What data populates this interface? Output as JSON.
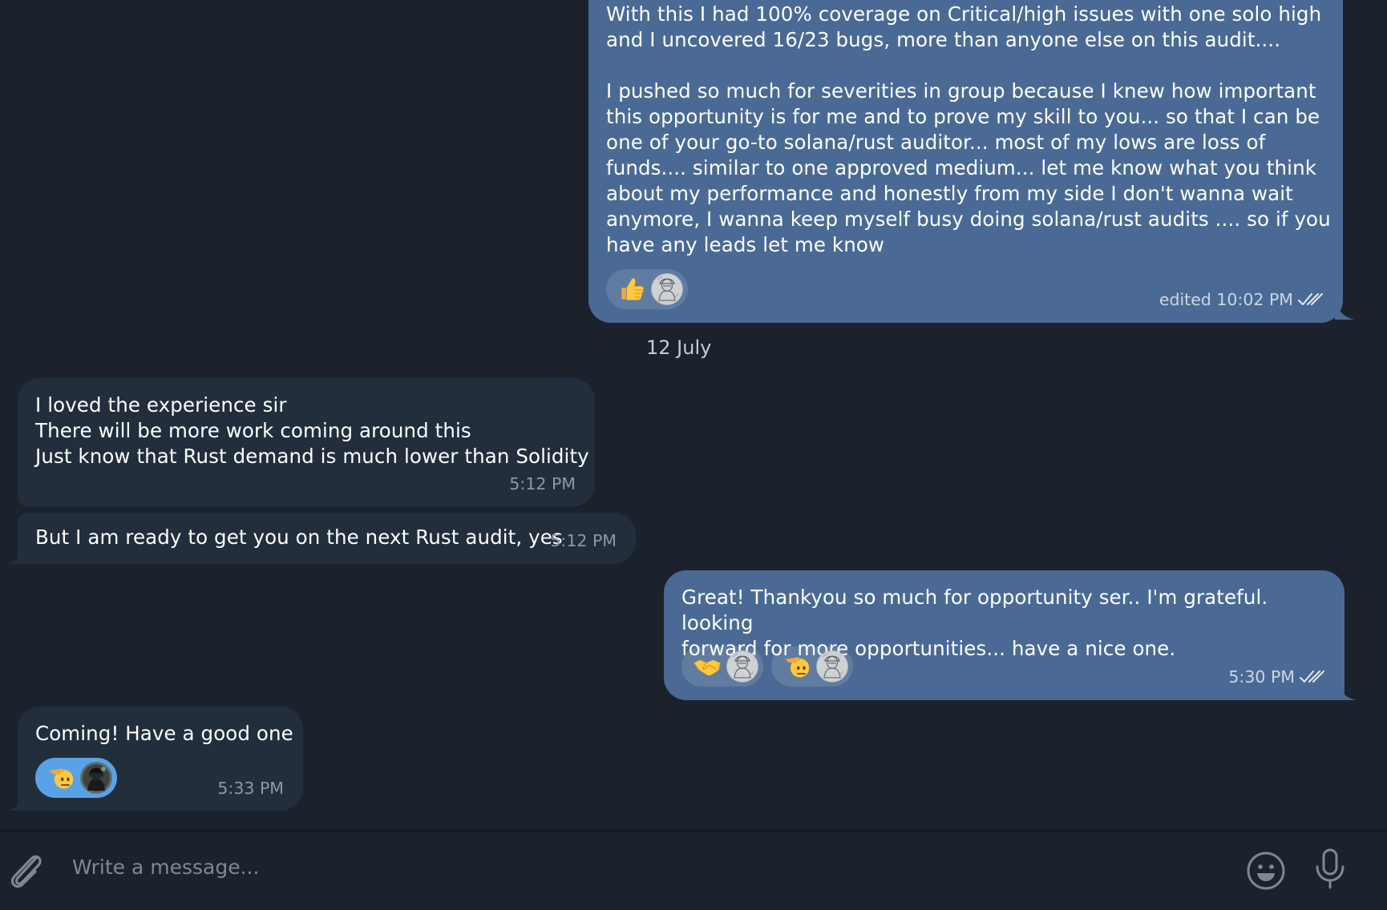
{
  "colors": {
    "background": "#1b222c",
    "outgoing_bubble": "#4a6a95",
    "incoming_bubble": "#232e3c",
    "active_reaction": "#5aa2e6",
    "read_check": "#ffffff"
  },
  "messages": [
    {
      "direction": "outgoing",
      "text": "With this I had 100% coverage on Critical/high issues with one solo high\nand I uncovered 16/23 bugs, more than anyone else on this audit....\n\nI pushed so much for severities in group because I knew how important\nthis opportunity is for me and to prove my skill to you... so that I can be\none of your go-to solana/rust auditor... most of my lows are loss of\nfunds.... similar to one approved medium... let me know what you think\nabout my performance and honestly from my side I don't wanna wait\nanymore, I wanna keep myself busy doing solana/rust audits .... so if you\nhave any leads let me know",
      "time": "edited 10:02 PM",
      "status_icon": "double-check-icon",
      "reactions": [
        {
          "emoji": "👍",
          "emoji_icon": "thumbs-up-icon",
          "avatar_icon": "grey-sketch-avatar"
        }
      ]
    },
    {
      "direction": "incoming",
      "text": "I loved the experience sir\nThere will be more work coming around this\nJust know that Rust demand is much lower than Solidity",
      "time": "5:12 PM"
    },
    {
      "direction": "incoming",
      "text": "But I am ready to get you on the next Rust audit, yes",
      "time": "5:12 PM"
    },
    {
      "direction": "outgoing",
      "text": "Great! Thankyou so much for opportunity ser.. I'm grateful. looking\nforward for more opportunities... have a nice one.",
      "time": "5:30 PM",
      "status_icon": "double-check-icon",
      "reactions": [
        {
          "emoji": "🤝",
          "emoji_icon": "handshake-icon",
          "avatar_icon": "grey-sketch-avatar"
        },
        {
          "emoji": "🫡",
          "emoji_icon": "saluting-face-icon",
          "avatar_icon": "grey-sketch-avatar"
        }
      ]
    },
    {
      "direction": "incoming",
      "text": "Coming! Have a good one",
      "time": "5:33 PM",
      "reactions": [
        {
          "emoji": "🫡",
          "emoji_icon": "saluting-face-icon",
          "avatar_icon": "dark-photo-avatar",
          "active": true
        }
      ]
    }
  ],
  "date_separator": "12 July",
  "composer": {
    "placeholder": "Write a message...",
    "attach_icon": "paperclip-icon",
    "emoji_icon": "smiley-icon",
    "mic_icon": "microphone-icon"
  }
}
